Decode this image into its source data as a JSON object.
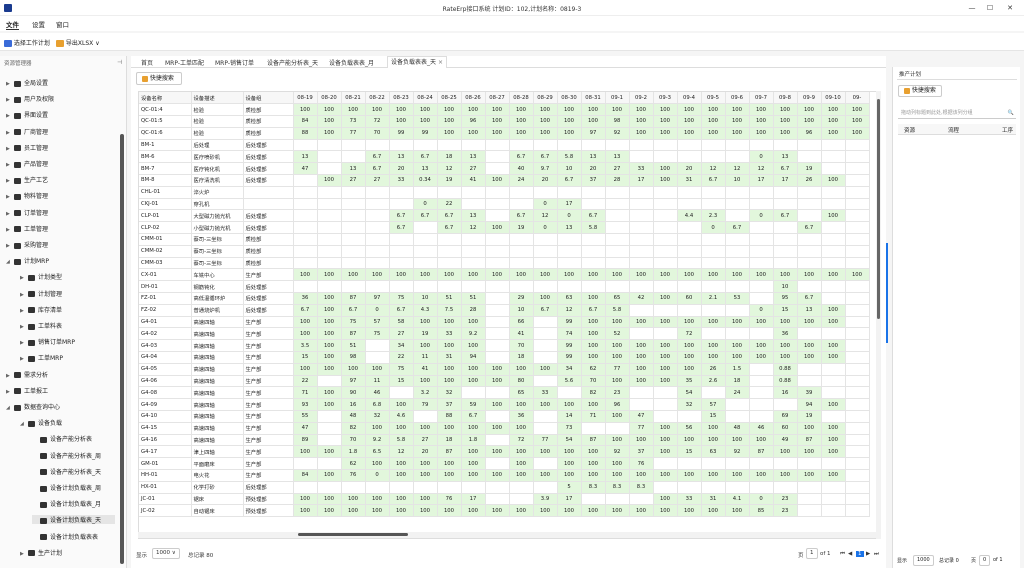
{
  "window": {
    "title": "RateErp接口系统 计划ID：102,计划名称：0819-3",
    "minimize": "—",
    "maximize": "☐",
    "close": "✕"
  },
  "menu": [
    "文件",
    "设置",
    "窗口"
  ],
  "toolbar": {
    "select_plan": "选择工作计划",
    "export": "导出XLSX",
    "export_caret": "∨"
  },
  "sidebar": {
    "title": "资源管理器",
    "pin": "⊣",
    "items": [
      {
        "label": "全局设置",
        "level": 0
      },
      {
        "label": "用户及权限",
        "level": 0
      },
      {
        "label": "界面设置",
        "level": 0
      },
      {
        "label": "厂商管理",
        "level": 0
      },
      {
        "label": "员工管理",
        "level": 0
      },
      {
        "label": "产品管理",
        "level": 0
      },
      {
        "label": "生产工艺",
        "level": 0
      },
      {
        "label": "物料管理",
        "level": 0
      },
      {
        "label": "订单管理",
        "level": 0
      },
      {
        "label": "工单管理",
        "level": 0
      },
      {
        "label": "采购管理",
        "level": 0
      },
      {
        "label": "计划MRP",
        "level": 0,
        "open": true
      },
      {
        "label": "计划类型",
        "level": 1
      },
      {
        "label": "计划管理",
        "level": 1
      },
      {
        "label": "库存清单",
        "level": 1
      },
      {
        "label": "工单料表",
        "level": 1
      },
      {
        "label": "销售订单MRP",
        "level": 1
      },
      {
        "label": "工单MRP",
        "level": 1
      },
      {
        "label": "需求分析",
        "level": 0
      },
      {
        "label": "工单报工",
        "level": 0
      },
      {
        "label": "数据查询中心",
        "level": 0,
        "open": true
      },
      {
        "label": "设备负载",
        "level": 1,
        "open": true
      },
      {
        "label": "设备产能分析表",
        "level": 2
      },
      {
        "label": "设备产能分析表_周",
        "level": 2
      },
      {
        "label": "设备产能分析表_天",
        "level": 2
      },
      {
        "label": "设备计划负载表_周",
        "level": 2
      },
      {
        "label": "设备计划负载表_月",
        "level": 2
      },
      {
        "label": "设备计划负载表_天",
        "level": 2,
        "selected": true
      },
      {
        "label": "设备计划负载表表",
        "level": 2
      },
      {
        "label": "生产计划",
        "level": 1
      }
    ]
  },
  "tabs": [
    "首页",
    "MRP-工单匹配",
    "MRP-销售订单",
    "设备产能分析表_天",
    "设备负载表表_月",
    "设备负载表表_天"
  ],
  "tab_close": "×",
  "quick_search": "快捷搜索",
  "grid": {
    "headers": [
      "设备名称",
      "设备描述",
      "设备组"
    ],
    "dates": [
      "08-19",
      "08-20",
      "08-21",
      "08-22",
      "08-23",
      "08-24",
      "08-25",
      "08-26",
      "08-27",
      "08-28",
      "08-29",
      "08-30",
      "08-31",
      "09-1",
      "09-2",
      "09-3",
      "09-4",
      "09-5",
      "09-6",
      "09-7",
      "09-8",
      "09-9",
      "09-10",
      "09-"
    ],
    "rows": [
      [
        "QC-01:4",
        "检验",
        "质检部",
        "100",
        "100",
        "100",
        "100",
        "100",
        "100",
        "100",
        "100",
        "100",
        "100",
        "100",
        "100",
        "100",
        "100",
        "100",
        "100",
        "100",
        "100",
        "100",
        "100",
        "100",
        "100",
        "100",
        "100"
      ],
      [
        "QC-01:5",
        "检验",
        "质检部",
        "84",
        "100",
        "73",
        "72",
        "100",
        "100",
        "100",
        "96",
        "100",
        "100",
        "100",
        "100",
        "100",
        "98",
        "100",
        "100",
        "100",
        "100",
        "100",
        "100",
        "100",
        "100",
        "100",
        "100"
      ],
      [
        "QC-01:6",
        "检验",
        "质检部",
        "88",
        "100",
        "77",
        "70",
        "99",
        "99",
        "100",
        "100",
        "100",
        "100",
        "100",
        "100",
        "97",
        "92",
        "100",
        "100",
        "100",
        "100",
        "100",
        "100",
        "100",
        "96",
        "100",
        "100"
      ],
      [
        "BM-1",
        "后处理",
        "后处理部",
        "",
        "",
        "",
        "",
        "",
        "",
        "",
        "",
        "",
        "",
        "",
        "",
        "",
        "",
        "",
        "",
        "",
        "",
        "",
        "",
        "",
        "",
        "",
        ""
      ],
      [
        "BM-6",
        "医疗喷砂机",
        "后处理部",
        "13",
        "",
        "",
        "6.7",
        "13",
        "6.7",
        "18",
        "13",
        "",
        "6.7",
        "6.7",
        "5.8",
        "13",
        "13",
        "",
        "",
        "",
        "",
        "",
        "0",
        "13",
        "",
        "",
        ""
      ],
      [
        "BM-7",
        "医疗钝化机",
        "后处理部",
        "47",
        "",
        "13",
        "6.7",
        "20",
        "13",
        "12",
        "27",
        "",
        "40",
        "9.7",
        "10",
        "20",
        "27",
        "33",
        "100",
        "20",
        "12",
        "12",
        "12",
        "6.7",
        "19",
        "",
        ""
      ],
      [
        "BM-8",
        "医疗清洗机",
        "后处理部",
        "",
        "100",
        "27",
        "27",
        "33",
        "0.34",
        "19",
        "41",
        "100",
        "24",
        "20",
        "6.7",
        "37",
        "28",
        "17",
        "100",
        "31",
        "6.7",
        "10",
        "17",
        "17",
        "26",
        "100",
        ""
      ],
      [
        "CHL-01",
        "淬火炉",
        "",
        "",
        "",
        "",
        "",
        "",
        "",
        "",
        "",
        "",
        "",
        "",
        "",
        "",
        "",
        "",
        "",
        "",
        "",
        "",
        "",
        "",
        ""
      ],
      [
        "CKJ-01",
        "穿孔机",
        "",
        "",
        "",
        "",
        "",
        "",
        "0",
        "22",
        "",
        "",
        "",
        "0",
        "17",
        "",
        "",
        "",
        "",
        "",
        "",
        "",
        "",
        "",
        ""
      ],
      [
        "CLP-01",
        "大型磁力抛光机",
        "后处理部",
        "",
        "",
        "",
        "",
        "6.7",
        "6.7",
        "6.7",
        "13",
        "",
        "6.7",
        "12",
        "0",
        "6.7",
        "",
        "",
        "",
        "4.4",
        "2.3",
        "",
        "0",
        "6.7",
        "",
        "100",
        ""
      ],
      [
        "CLP-02",
        "小型磁力抛光机",
        "后处理部",
        "",
        "",
        "",
        "",
        "6.7",
        "",
        "6.7",
        "12",
        "100",
        "19",
        "0",
        "13",
        "5.8",
        "",
        "",
        "",
        "",
        "0",
        "6.7",
        "",
        "",
        "6.7",
        "",
        ""
      ],
      [
        "CMM-01",
        "蔡司-三坐标",
        "质检部",
        "",
        "",
        "",
        "",
        "",
        "",
        "",
        "",
        "",
        "",
        "",
        "",
        "",
        "",
        "",
        "",
        "",
        "",
        "",
        "",
        "",
        "",
        ""
      ],
      [
        "CMM-02",
        "蔡司-三坐标",
        "质检部",
        "",
        "",
        "",
        "",
        "",
        "",
        "",
        "",
        "",
        "",
        "",
        "",
        "",
        "",
        "",
        "",
        "",
        "",
        "",
        "",
        "",
        "",
        ""
      ],
      [
        "CMM-03",
        "蔡司-三坐标",
        "质检部",
        "",
        "",
        "",
        "",
        "",
        "",
        "",
        "",
        "",
        "",
        "",
        "",
        "",
        "",
        "",
        "",
        "",
        "",
        "",
        "",
        "",
        "",
        ""
      ],
      [
        "CX-01",
        "车铣中心",
        "生产部",
        "100",
        "100",
        "100",
        "100",
        "100",
        "100",
        "100",
        "100",
        "100",
        "100",
        "100",
        "100",
        "100",
        "100",
        "100",
        "100",
        "100",
        "100",
        "100",
        "100",
        "100",
        "100",
        "100",
        "100"
      ],
      [
        "DH-01",
        "钢筋钝化",
        "后处理部",
        "",
        "",
        "",
        "",
        "",
        "",
        "",
        "",
        "",
        "",
        "",
        "",
        "",
        "",
        "",
        "",
        "",
        "",
        "",
        "",
        "10",
        "",
        ""
      ],
      [
        "FZ-01",
        "高低温循环炉",
        "后处理部",
        "36",
        "100",
        "87",
        "97",
        "75",
        "10",
        "51",
        "51",
        "",
        "29",
        "100",
        "63",
        "100",
        "65",
        "42",
        "100",
        "60",
        "2.1",
        "53",
        "",
        "95",
        "6.7",
        "",
        ""
      ],
      [
        "FZ-02",
        "普通烧炉机",
        "后处理部",
        "6.7",
        "100",
        "6.7",
        "0",
        "6.7",
        "4.3",
        "7.5",
        "28",
        "",
        "10",
        "6.7",
        "12",
        "6.7",
        "5.8",
        "",
        "",
        "",
        "",
        "",
        "0",
        "15",
        "13",
        "100",
        ""
      ],
      [
        "G4-01",
        "高速四轴",
        "生产部",
        "100",
        "100",
        "75",
        "57",
        "58",
        "100",
        "100",
        "100",
        "",
        "66",
        "",
        "99",
        "100",
        "100",
        "100",
        "100",
        "100",
        "100",
        "100",
        "100",
        "100",
        "100",
        "100",
        ""
      ],
      [
        "G4-02",
        "高速四轴",
        "生产部",
        "100",
        "100",
        "87",
        "75",
        "27",
        "19",
        "33",
        "9.2",
        "",
        "41",
        "",
        "74",
        "100",
        "52",
        "",
        "",
        "72",
        "",
        "",
        "",
        "36",
        "",
        "",
        ""
      ],
      [
        "G4-03",
        "高速四轴",
        "生产部",
        "3.5",
        "100",
        "51",
        "",
        "34",
        "100",
        "100",
        "100",
        "",
        "70",
        "",
        "99",
        "100",
        "100",
        "100",
        "100",
        "100",
        "100",
        "100",
        "100",
        "100",
        "100",
        "100",
        ""
      ],
      [
        "G4-04",
        "高速四轴",
        "生产部",
        "15",
        "100",
        "98",
        "",
        "22",
        "11",
        "31",
        "94",
        "",
        "18",
        "",
        "99",
        "100",
        "100",
        "100",
        "100",
        "100",
        "100",
        "100",
        "100",
        "100",
        "100",
        "100",
        ""
      ],
      [
        "G4-05",
        "高速四轴",
        "生产部",
        "100",
        "100",
        "100",
        "100",
        "75",
        "41",
        "100",
        "100",
        "100",
        "100",
        "100",
        "34",
        "62",
        "77",
        "100",
        "100",
        "100",
        "26",
        "1.5",
        "",
        "0.88",
        "",
        "",
        ""
      ],
      [
        "G4-06",
        "高速四轴",
        "生产部",
        "22",
        "",
        "97",
        "11",
        "15",
        "100",
        "100",
        "100",
        "100",
        "80",
        "",
        "5.6",
        "70",
        "100",
        "100",
        "100",
        "35",
        "2.6",
        "18",
        "",
        "0.88",
        "",
        "",
        ""
      ],
      [
        "G4-08",
        "高速四轴",
        "生产部",
        "71",
        "100",
        "90",
        "46",
        "",
        "3.2",
        "32",
        "",
        "",
        "65",
        "33",
        "",
        "82",
        "23",
        "",
        "",
        "54",
        "",
        "24",
        "",
        "16",
        "39",
        "",
        ""
      ],
      [
        "G4-09",
        "高速四轴",
        "生产部",
        "93",
        "100",
        "16",
        "6.8",
        "100",
        "79",
        "37",
        "59",
        "100",
        "100",
        "100",
        "100",
        "100",
        "96",
        "",
        "",
        "32",
        "57",
        "",
        "",
        "",
        "94",
        "100",
        ""
      ],
      [
        "G4-10",
        "高速四轴",
        "生产部",
        "55",
        "",
        "48",
        "32",
        "4.6",
        "",
        "88",
        "6.7",
        "",
        "36",
        "",
        "14",
        "71",
        "100",
        "47",
        "",
        "",
        "15",
        "",
        "",
        "69",
        "19",
        "",
        ""
      ],
      [
        "G4-15",
        "高速四轴",
        "生产部",
        "47",
        "",
        "82",
        "100",
        "100",
        "100",
        "100",
        "100",
        "100",
        "100",
        "",
        "73",
        "",
        "",
        "77",
        "100",
        "56",
        "100",
        "48",
        "46",
        "60",
        "100",
        "100",
        ""
      ],
      [
        "G4-16",
        "高速四轴",
        "生产部",
        "89",
        "",
        "70",
        "9.2",
        "5.8",
        "27",
        "18",
        "1.8",
        "",
        "72",
        "77",
        "54",
        "87",
        "100",
        "100",
        "100",
        "100",
        "100",
        "100",
        "100",
        "49",
        "87",
        "100",
        ""
      ],
      [
        "G4-17",
        "津上四轴",
        "生产部",
        "100",
        "100",
        "1.8",
        "6.5",
        "12",
        "20",
        "87",
        "100",
        "100",
        "100",
        "100",
        "100",
        "100",
        "92",
        "37",
        "100",
        "15",
        "63",
        "92",
        "87",
        "100",
        "100",
        "100",
        ""
      ],
      [
        "GM-01",
        "平面磨床",
        "生产部",
        "",
        "",
        "62",
        "100",
        "100",
        "100",
        "100",
        "100",
        "",
        "100",
        "",
        "100",
        "100",
        "100",
        "76",
        "",
        "",
        "",
        "",
        "",
        "",
        "",
        "",
        ""
      ],
      [
        "HH-01",
        "电火花",
        "生产部",
        "84",
        "100",
        "76",
        "0",
        "100",
        "100",
        "100",
        "100",
        "100",
        "100",
        "100",
        "100",
        "100",
        "100",
        "100",
        "100",
        "100",
        "100",
        "100",
        "100",
        "100",
        "100",
        "100",
        ""
      ],
      [
        "HX-01",
        "化学打砂",
        "后处理部",
        "",
        "",
        "",
        "",
        "",
        "",
        "",
        "",
        "",
        "",
        "",
        "5",
        "8.3",
        "8.3",
        "8.3",
        "",
        "",
        "",
        "",
        "",
        "",
        "",
        "",
        ""
      ],
      [
        "JC-01",
        "锯床",
        "预处理部",
        "100",
        "100",
        "100",
        "100",
        "100",
        "100",
        "76",
        "17",
        "",
        "",
        "3.9",
        "17",
        "",
        "",
        "",
        "100",
        "33",
        "31",
        "4.1",
        "0",
        "23",
        "",
        "",
        ""
      ],
      [
        "JC-02",
        "自动锯床",
        "预处理部",
        "100",
        "100",
        "100",
        "100",
        "100",
        "100",
        "100",
        "100",
        "100",
        "100",
        "100",
        "100",
        "100",
        "100",
        "100",
        "100",
        "100",
        "100",
        "100",
        "85",
        "23",
        "",
        "",
        ""
      ]
    ]
  },
  "footer": {
    "show_label": "显示",
    "page_size": "1000",
    "caret": "∨",
    "total": "总记录 80",
    "page_label": "页",
    "page": "1",
    "of": "of 1",
    "pager_first": "⏮",
    "pager_prev": "◀",
    "pager_cur": "1",
    "pager_next": "▶",
    "pager_last": "⏭"
  },
  "right_panel": {
    "tab": "推产计划",
    "quick_search": "快捷搜索",
    "search_placeholder": "拖动列标题到此处,根据该列分组",
    "search_icon": "🔍",
    "columns": [
      "资源",
      "流程",
      "工序"
    ],
    "show_label": "显示",
    "page_size": "1000",
    "total": "总记录 0",
    "page_label": "页",
    "page": "0",
    "of": "of 1"
  },
  "colors": {
    "accent": "#1a73e8",
    "cell_green": "#e2f7dc",
    "brand": "#1a3b8f"
  }
}
